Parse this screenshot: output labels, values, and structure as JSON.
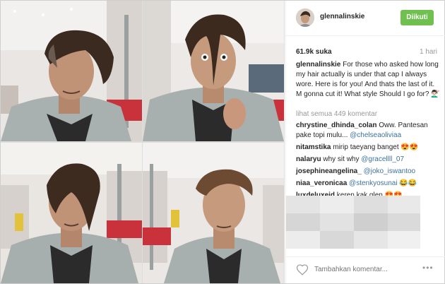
{
  "post": {
    "images": [
      {
        "name": "hair-side-profile-photo"
      },
      {
        "name": "hair-over-eye-photo"
      },
      {
        "name": "hair-covering-face-photo"
      },
      {
        "name": "hair-side-swept-photo"
      }
    ]
  },
  "header": {
    "username": "glennalinskie",
    "follow_label": "Diikuti",
    "follow_color": "#70c050"
  },
  "stats": {
    "likes": "61.9k suka",
    "time": "1 hari"
  },
  "caption": {
    "username": "glennalinskie",
    "text": " For those who asked how long my hair actually is under that cap I always wore. Here is for you! And thats the last of it. M gonna cut it! What style Should I go for? 💇🏻‍♂️"
  },
  "view_all": "lihat semua 449 komentar",
  "comments": [
    {
      "user": "chrystine_dhinda_colan",
      "text": " Oww. Pantesan pake topi mulu... ",
      "mention": "@chelseaoliviaa"
    },
    {
      "user": "nitamstika",
      "text": " mirip taeyang banget 😍😍",
      "mention": ""
    },
    {
      "user": "nalaryu",
      "text": " why sit why ",
      "mention": "@gracellll_07"
    },
    {
      "user": "josephineangelina_",
      "text": " ",
      "mention": "@joko_iswantoo"
    },
    {
      "user": "niaa_veronicaa",
      "text": " ",
      "mention": "@stenkyosunai",
      "tail": " 😂😂"
    },
    {
      "user": "luxdeluxeid",
      "text": " keren kak glen 😍😍",
      "mention": ""
    }
  ],
  "footer": {
    "add_comment_placeholder": "Tambahkan komentar...",
    "more_label": "•••"
  },
  "colors": {
    "mention": "#3f729b",
    "muted": "#999999"
  }
}
